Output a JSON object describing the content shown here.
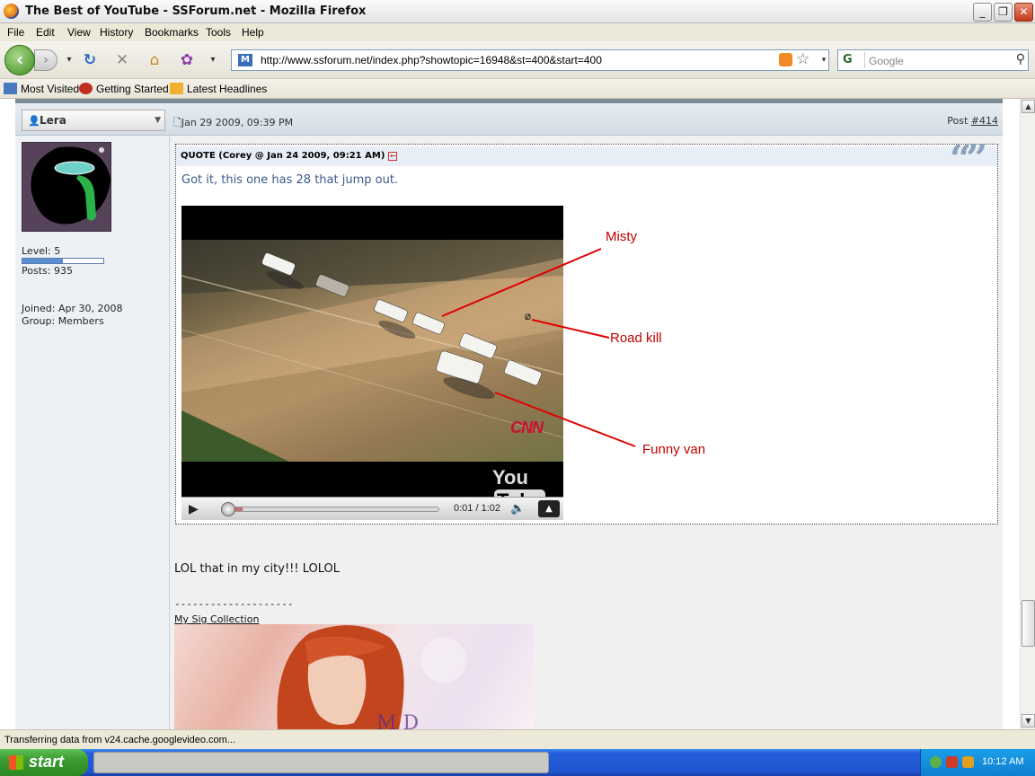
{
  "window": {
    "title": "The Best of YouTube - SSForum.net - Mozilla Firefox",
    "minimize": "_",
    "restore": "❐",
    "close": "✕"
  },
  "menu": [
    "File",
    "Edit",
    "View",
    "History",
    "Bookmarks",
    "Tools",
    "Help"
  ],
  "toolbar": {
    "url": "http://www.ssforum.net/index.php?showtopic=16948&st=400&start=400",
    "search_placeholder": "Google",
    "search_engine": "G"
  },
  "bookmarks": [
    "Most Visited",
    "Getting Started",
    "Latest Headlines"
  ],
  "post": {
    "username": "Lera",
    "date": "Jan 29 2009, 09:39 PM",
    "post_label": "Post",
    "post_number": "#414",
    "level": "Level: 5",
    "level_fraction": 0.5,
    "posts": "Posts: 935",
    "joined": "Joined: Apr 30, 2008",
    "group": "Group: Members",
    "quote_header": "QUOTE (Corey @ Jan 24 2009, 09:21 AM)",
    "quote_text": "Got it, this one has 28 that jump out.",
    "video": {
      "channel_logo": "CNN",
      "yt_logo_you": "You",
      "yt_logo_tube": "Tube",
      "time": "0:01 / 1:02",
      "progress_fraction": 0.02
    },
    "annotations": [
      "Misty",
      "Road kill",
      "Funny van"
    ],
    "body": "LOL that in my city!!! LOLOL",
    "sig_divider": "--------------------",
    "sig_link": "My Sig Collection"
  },
  "status": "Transferring data from v24.cache.googlevideo.com...",
  "taskbar": {
    "start": "start",
    "clock": "10:12 AM"
  },
  "colors": {
    "annotation": "#c00000",
    "quote_text": "#3b5a8a",
    "taskbar": "#245edb"
  }
}
